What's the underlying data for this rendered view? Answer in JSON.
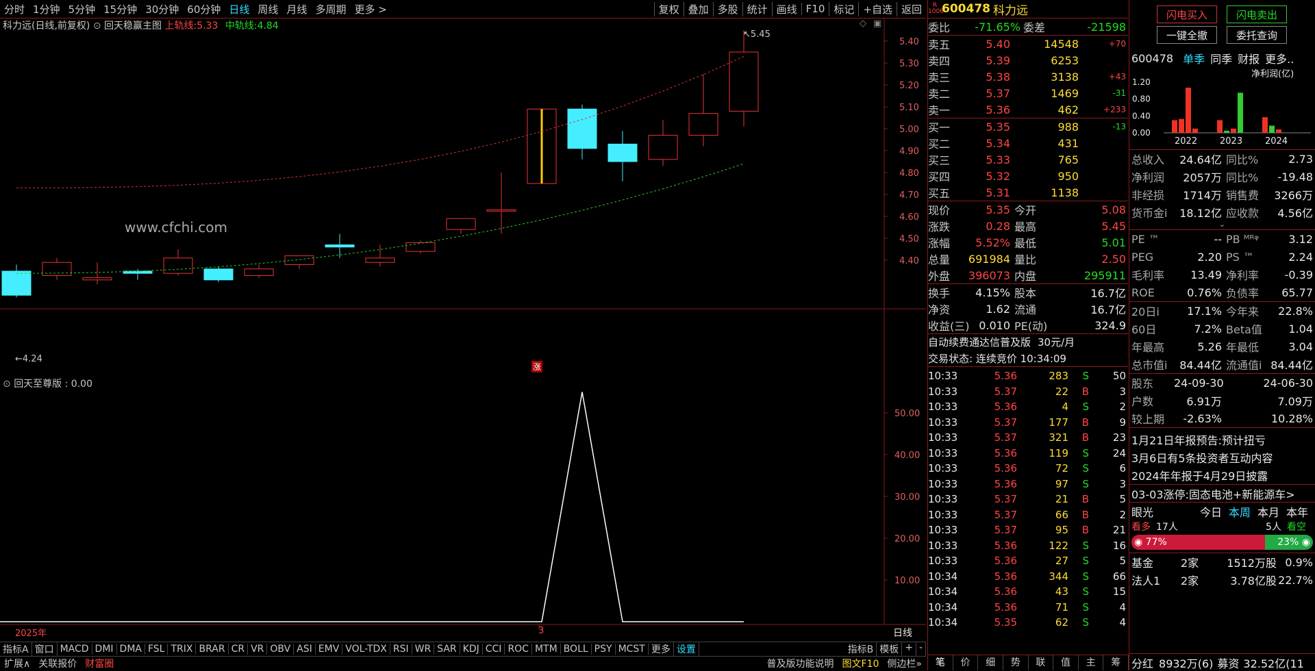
{
  "period_tabs": [
    "分时",
    "1分钟",
    "5分钟",
    "15分钟",
    "30分钟",
    "60分钟",
    "日线",
    "周线",
    "月线",
    "多周期",
    "更多 >"
  ],
  "active_period": "日线",
  "tools": [
    "复权",
    "叠加",
    "多股",
    "统计",
    "画线",
    "F10",
    "标记",
    "+自选",
    "返回"
  ],
  "main_title": "科力远(日线,前复权)",
  "indicator_name": "回天稳赢主图",
  "upper_track": {
    "label": "上轨线:",
    "value": "5.33"
  },
  "mid_track": {
    "label": "中轨线:",
    "value": "4.84"
  },
  "high_marker": "5.45",
  "low_marker": "4.24",
  "watermark": "www.cfchi.com",
  "limit_up_mark": "涨",
  "price_axis": [
    "5.40",
    "5.30",
    "5.20",
    "5.10",
    "5.00",
    "4.90",
    "4.80",
    "4.70",
    "4.60",
    "4.50",
    "4.40"
  ],
  "sub_title": "回天至尊版 : 0.00",
  "sub_axis": [
    "50.00",
    "40.00",
    "30.00",
    "20.00",
    "10.00"
  ],
  "date_labels": {
    "year": "2025年",
    "month": "3",
    "axis_mode": "日线"
  },
  "chart_data": {
    "type": "candlestick",
    "candles": [
      {
        "o": 4.35,
        "h": 4.38,
        "l": 4.23,
        "c": 4.24
      },
      {
        "o": 4.33,
        "h": 4.41,
        "l": 4.31,
        "c": 4.39
      },
      {
        "o": 4.31,
        "h": 4.39,
        "l": 4.29,
        "c": 4.32
      },
      {
        "o": 4.35,
        "h": 4.36,
        "l": 4.31,
        "c": 4.34
      },
      {
        "o": 4.34,
        "h": 4.45,
        "l": 4.33,
        "c": 4.41
      },
      {
        "o": 4.36,
        "h": 4.37,
        "l": 4.3,
        "c": 4.31
      },
      {
        "o": 4.33,
        "h": 4.38,
        "l": 4.32,
        "c": 4.36
      },
      {
        "o": 4.38,
        "h": 4.42,
        "l": 4.36,
        "c": 4.42
      },
      {
        "o": 4.47,
        "h": 4.52,
        "l": 4.41,
        "c": 4.46
      },
      {
        "o": 4.39,
        "h": 4.47,
        "l": 4.37,
        "c": 4.41
      },
      {
        "o": 4.44,
        "h": 4.49,
        "l": 4.43,
        "c": 4.48
      },
      {
        "o": 4.54,
        "h": 4.59,
        "l": 4.52,
        "c": 4.59
      },
      {
        "o": 4.63,
        "h": 4.8,
        "l": 4.52,
        "c": 4.63
      },
      {
        "o": 4.75,
        "h": 5.09,
        "l": 4.75,
        "c": 5.09
      },
      {
        "o": 5.09,
        "h": 5.11,
        "l": 4.86,
        "c": 4.91
      },
      {
        "o": 4.93,
        "h": 4.99,
        "l": 4.76,
        "c": 4.85
      },
      {
        "o": 4.86,
        "h": 5.04,
        "l": 4.83,
        "c": 4.97
      },
      {
        "o": 4.97,
        "h": 5.25,
        "l": 4.92,
        "c": 5.07
      },
      {
        "o": 5.08,
        "h": 5.45,
        "l": 5.01,
        "c": 5.35
      }
    ],
    "sub_values": [
      0,
      0,
      0,
      0,
      0,
      0,
      0,
      0,
      0,
      0,
      0,
      0,
      0,
      0,
      55,
      0,
      0,
      0,
      0
    ]
  },
  "stock": {
    "code": "600478",
    "name": "科力远",
    "badge": "R",
    "sub_badge": "1006"
  },
  "order_ratio": {
    "label": "委比",
    "value": "-71.65%",
    "diff_label": "委差",
    "diff": "-21598"
  },
  "asks": [
    {
      "label": "卖五",
      "price": "5.40",
      "vol": "14548",
      "chg": "+70"
    },
    {
      "label": "卖四",
      "price": "5.39",
      "vol": "6253",
      "chg": ""
    },
    {
      "label": "卖三",
      "price": "5.38",
      "vol": "3138",
      "chg": "+43"
    },
    {
      "label": "卖二",
      "price": "5.37",
      "vol": "1469",
      "chg": "-31"
    },
    {
      "label": "卖一",
      "price": "5.36",
      "vol": "462",
      "chg": "+233"
    }
  ],
  "bids": [
    {
      "label": "买一",
      "price": "5.35",
      "vol": "988",
      "chg": "-13"
    },
    {
      "label": "买二",
      "price": "5.34",
      "vol": "431",
      "chg": ""
    },
    {
      "label": "买三",
      "price": "5.33",
      "vol": "765",
      "chg": ""
    },
    {
      "label": "买四",
      "price": "5.32",
      "vol": "950",
      "chg": ""
    },
    {
      "label": "买五",
      "price": "5.31",
      "vol": "1138",
      "chg": ""
    }
  ],
  "stats1": [
    {
      "l1": "现价",
      "v1": "5.35",
      "c1": "red",
      "l2": "今开",
      "v2": "5.08",
      "c2": "red"
    },
    {
      "l1": "涨跌",
      "v1": "0.28",
      "c1": "red",
      "l2": "最高",
      "v2": "5.45",
      "c2": "red"
    },
    {
      "l1": "涨幅",
      "v1": "5.52%",
      "c1": "red",
      "l2": "最低",
      "v2": "5.01",
      "c2": "grn"
    },
    {
      "l1": "总量",
      "v1": "691984",
      "c1": "yel",
      "l2": "量比",
      "v2": "2.50",
      "c2": "red"
    },
    {
      "l1": "外盘",
      "v1": "396073",
      "c1": "red",
      "l2": "内盘",
      "v2": "295911",
      "c2": "grn"
    }
  ],
  "stats2": [
    {
      "l1": "换手",
      "v1": "4.15%",
      "l2": "股本",
      "v2": "16.7亿"
    },
    {
      "l1": "净资",
      "v1": "1.62",
      "l2": "流通",
      "v2": "16.7亿"
    },
    {
      "l1": "收益(三)",
      "v1": "0.010",
      "l2": "PE(动)",
      "v2": "324.9"
    }
  ],
  "promo": {
    "text": "自动续费通达信普及版",
    "price": "30元/月"
  },
  "trade_status": "交易状态: 连续竞价 10:34:09",
  "ticks": [
    {
      "t": "10:33",
      "p": "5.36",
      "v": "283",
      "s": "S",
      "n": "50"
    },
    {
      "t": "10:33",
      "p": "5.37",
      "v": "22",
      "s": "B",
      "n": "3"
    },
    {
      "t": "10:33",
      "p": "5.36",
      "v": "4",
      "s": "S",
      "n": "2"
    },
    {
      "t": "10:33",
      "p": "5.37",
      "v": "177",
      "s": "B",
      "n": "9"
    },
    {
      "t": "10:33",
      "p": "5.37",
      "v": "321",
      "s": "B",
      "n": "23"
    },
    {
      "t": "10:33",
      "p": "5.36",
      "v": "119",
      "s": "S",
      "n": "24"
    },
    {
      "t": "10:33",
      "p": "5.36",
      "v": "72",
      "s": "S",
      "n": "6"
    },
    {
      "t": "10:33",
      "p": "5.36",
      "v": "97",
      "s": "S",
      "n": "3"
    },
    {
      "t": "10:33",
      "p": "5.37",
      "v": "21",
      "s": "B",
      "n": "5"
    },
    {
      "t": "10:33",
      "p": "5.37",
      "v": "66",
      "s": "B",
      "n": "2"
    },
    {
      "t": "10:33",
      "p": "5.37",
      "v": "95",
      "s": "B",
      "n": "21"
    },
    {
      "t": "10:33",
      "p": "5.36",
      "v": "122",
      "s": "S",
      "n": "16"
    },
    {
      "t": "10:33",
      "p": "5.36",
      "v": "27",
      "s": "S",
      "n": "5"
    },
    {
      "t": "10:34",
      "p": "5.36",
      "v": "344",
      "s": "S",
      "n": "66"
    },
    {
      "t": "10:34",
      "p": "5.36",
      "v": "43",
      "s": "S",
      "n": "15"
    },
    {
      "t": "10:34",
      "p": "5.36",
      "v": "71",
      "s": "S",
      "n": "4"
    },
    {
      "t": "10:34",
      "p": "5.35",
      "v": "62",
      "s": "S",
      "n": "4"
    }
  ],
  "quote_tabs": [
    "笔",
    "价",
    "细",
    "势",
    "联",
    "值",
    "主",
    "筹"
  ],
  "buttons": {
    "flash_buy": "闪电买入",
    "flash_sell": "闪电卖出",
    "cancel_all": "一键全撤",
    "order_query": "委托查询"
  },
  "fin_tabs": {
    "code": "600478",
    "single": "单季",
    "same": "同季",
    "report": "财报",
    "more": "更多.."
  },
  "profit_chart": {
    "title": "净利润(亿)",
    "y": [
      "1.20",
      "0.80",
      "0.40",
      "0.00"
    ],
    "years": [
      "2022",
      "2023",
      "2024"
    ],
    "bars": [
      {
        "v": 0.3,
        "c": "#ee3322"
      },
      {
        "v": 0.33,
        "c": "#ee3322"
      },
      {
        "v": 1.07,
        "c": "#ee3322"
      },
      {
        "v": 0.1,
        "c": "#ee3322"
      },
      {
        "v": 0.3,
        "c": "#ee3322"
      },
      {
        "v": 0.05,
        "c": "#33cc33"
      },
      {
        "v": 0.1,
        "c": "#ee3322"
      },
      {
        "v": 0.95,
        "c": "#33cc33"
      },
      {
        "v": 0.37,
        "c": "#ee3322"
      },
      {
        "v": 0.17,
        "c": "#33cc33"
      },
      {
        "v": 0.08,
        "c": "#ee3322"
      }
    ]
  },
  "fundamentals": [
    {
      "l1": "总收入",
      "v1": "24.64亿",
      "l2": "同比%",
      "v2": "2.73"
    },
    {
      "l1": "净利润",
      "v1": "2057万",
      "l2": "同比%",
      "v2": "-19.48"
    },
    {
      "l1": "非经损",
      "v1": "1714万",
      "l2": "销售费",
      "v2": "3266万"
    },
    {
      "l1": "货币金i",
      "v1": "18.12亿",
      "l2": "应收款",
      "v2": "4.56亿"
    }
  ],
  "ratios": [
    {
      "l1": "PE ™",
      "v1": "--",
      "l2": "PB ᴹᴿᵠ",
      "v2": "3.12"
    },
    {
      "l1": "PEG",
      "v1": "2.20",
      "l2": "PS ™",
      "v2": "2.24"
    },
    {
      "l1": "毛利率",
      "v1": "13.49",
      "l2": "净利率",
      "v2": "-0.39"
    },
    {
      "l1": "ROE",
      "v1": "0.76%",
      "l2": "负债率",
      "v2": "65.77"
    }
  ],
  "perf": [
    {
      "l1": "20日i",
      "v1": "17.1%",
      "l2": "今年来",
      "v2": "22.8%"
    },
    {
      "l1": "60日",
      "v1": "7.2%",
      "l2": "Beta值",
      "v2": "1.04"
    },
    {
      "l1": "年最高",
      "v1": "5.26",
      "l2": "年最低",
      "v2": "3.04"
    },
    {
      "l1": "总市值i",
      "v1": "84.44亿",
      "l2": "流通值i",
      "v2": "84.44亿"
    }
  ],
  "holders": [
    {
      "l1": "股东",
      "v1": "24-09-30",
      "v2": "24-06-30"
    },
    {
      "l1": "户数",
      "v1": "6.91万",
      "v2": "7.09万"
    },
    {
      "l1": "较上期",
      "v1": "-2.63%",
      "v2": "10.28%"
    }
  ],
  "news": [
    "1月21日年报预告:预计扭亏",
    "3月6日有5条投资者互动内容",
    "2024年年报于4月29日披露"
  ],
  "limit_news": "03-03涨停:固态电池+新能源车>",
  "sentiment": {
    "label": "眼光",
    "today": "今日",
    "week": "本周",
    "month": "本月",
    "year": "本年",
    "bull": "看多",
    "bull_n": "17人",
    "bear_n": "5人",
    "bear": "看空",
    "bull_pct": "77%",
    "bear_pct": "23%"
  },
  "inst": [
    {
      "l": "基金",
      "n": "2家",
      "v": "1512万股",
      "p": "0.9%"
    },
    {
      "l": "法人1",
      "n": "2家",
      "v": "3.78亿股",
      "p": "22.7%"
    }
  ],
  "dividend": {
    "label": "分红",
    "value": "8932万(6)",
    "l2": "募资",
    "v2": "32.52亿(11"
  },
  "indicators": [
    "指标A",
    "窗口",
    "MACD",
    "DMI",
    "DMA",
    "FSL",
    "TRIX",
    "BRAR",
    "CR",
    "VR",
    "OBV",
    "ASI",
    "EMV",
    "VOL-TDX",
    "RSI",
    "WR",
    "SAR",
    "KDJ",
    "CCI",
    "ROC",
    "MTM",
    "BOLL",
    "PSY",
    "MCST",
    "更多",
    "设置"
  ],
  "indicator_right": [
    "指标B",
    "模板",
    "+",
    "-"
  ],
  "status_items": [
    "扩展∧",
    "关联报价",
    "财富圈"
  ],
  "status_right": [
    "普及版功能说明",
    "图文F10",
    "侧边栏»"
  ]
}
